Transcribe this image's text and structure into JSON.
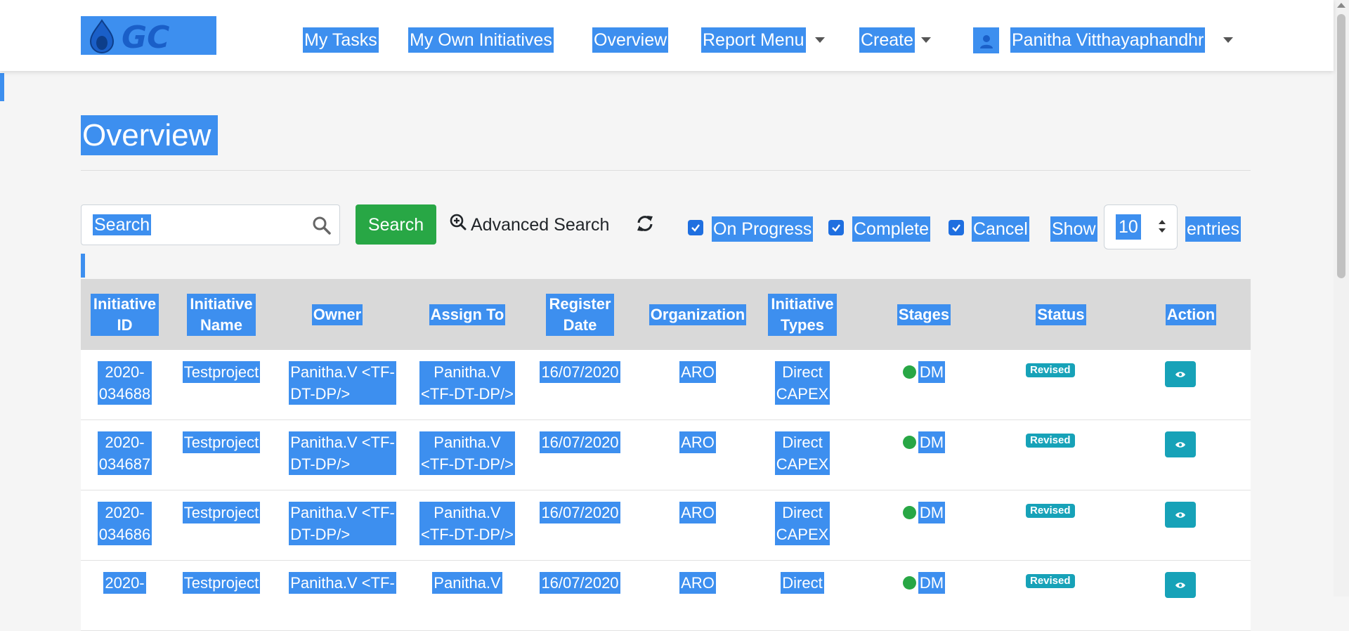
{
  "nav": {
    "logo_text": "GC",
    "items": [
      {
        "label": "My Tasks"
      },
      {
        "label": "My Own Initiatives"
      },
      {
        "label": "Overview"
      },
      {
        "label": "Report Menu"
      },
      {
        "label": "Create"
      }
    ],
    "user_name": "Panitha Vitthayaphandhr"
  },
  "page": {
    "title": "Overview"
  },
  "toolbar": {
    "search_placeholder": "Search",
    "search_button": "Search",
    "advanced_search": "Advanced Search",
    "filters": [
      {
        "label": "On Progress",
        "checked": true
      },
      {
        "label": "Complete",
        "checked": true
      },
      {
        "label": "Cancel",
        "checked": true
      }
    ],
    "show_label": "Show",
    "entries_value": "10",
    "entries_label": "entries"
  },
  "table": {
    "headers": [
      {
        "line1": "Initiative",
        "line2": "ID"
      },
      {
        "line1": "Initiative",
        "line2": "Name"
      },
      {
        "line1": "Owner",
        "line2": ""
      },
      {
        "line1": "Assign To",
        "line2": ""
      },
      {
        "line1": "Register",
        "line2": "Date"
      },
      {
        "line1": "Organization",
        "line2": ""
      },
      {
        "line1": "Initiative",
        "line2": "Types"
      },
      {
        "line1": "Stages",
        "line2": ""
      },
      {
        "line1": "Status",
        "line2": ""
      },
      {
        "line1": "Action",
        "line2": ""
      }
    ],
    "rows": [
      {
        "id1": "2020-",
        "id2": "034688",
        "name": "Testproject",
        "owner1": "Panitha.V <TF-",
        "owner2": "DT-DP/>",
        "assign1": "Panitha.V",
        "assign2": "<TF-DT-DP/>",
        "date": "16/07/2020",
        "org": "ARO",
        "type1": "Direct",
        "type2": "CAPEX",
        "stage": "DM",
        "status": "Revised"
      },
      {
        "id1": "2020-",
        "id2": "034687",
        "name": "Testproject",
        "owner1": "Panitha.V <TF-",
        "owner2": "DT-DP/>",
        "assign1": "Panitha.V",
        "assign2": "<TF-DT-DP/>",
        "date": "16/07/2020",
        "org": "ARO",
        "type1": "Direct",
        "type2": "CAPEX",
        "stage": "DM",
        "status": "Revised"
      },
      {
        "id1": "2020-",
        "id2": "034686",
        "name": "Testproject",
        "owner1": "Panitha.V <TF-",
        "owner2": "DT-DP/>",
        "assign1": "Panitha.V",
        "assign2": "<TF-DT-DP/>",
        "date": "16/07/2020",
        "org": "ARO",
        "type1": "Direct",
        "type2": "CAPEX",
        "stage": "DM",
        "status": "Revised"
      },
      {
        "id1": "2020-",
        "id2": "",
        "name": "Testproject",
        "owner1": "Panitha.V <TF-",
        "owner2": "",
        "assign1": "Panitha.V",
        "assign2": "",
        "date": "16/07/2020",
        "org": "ARO",
        "type1": "Direct",
        "type2": "",
        "stage": "DM",
        "status": "Revised"
      }
    ]
  },
  "colors": {
    "selection": "#3d8fef",
    "primary_green": "#28a745",
    "info_teal": "#17a2b8",
    "header_gray": "#d9d9d9"
  },
  "icons": {
    "search": "search-icon",
    "advanced": "zoom-in-icon",
    "refresh": "refresh-icon",
    "view": "eye-icon",
    "avatar": "user-avatar-icon"
  }
}
